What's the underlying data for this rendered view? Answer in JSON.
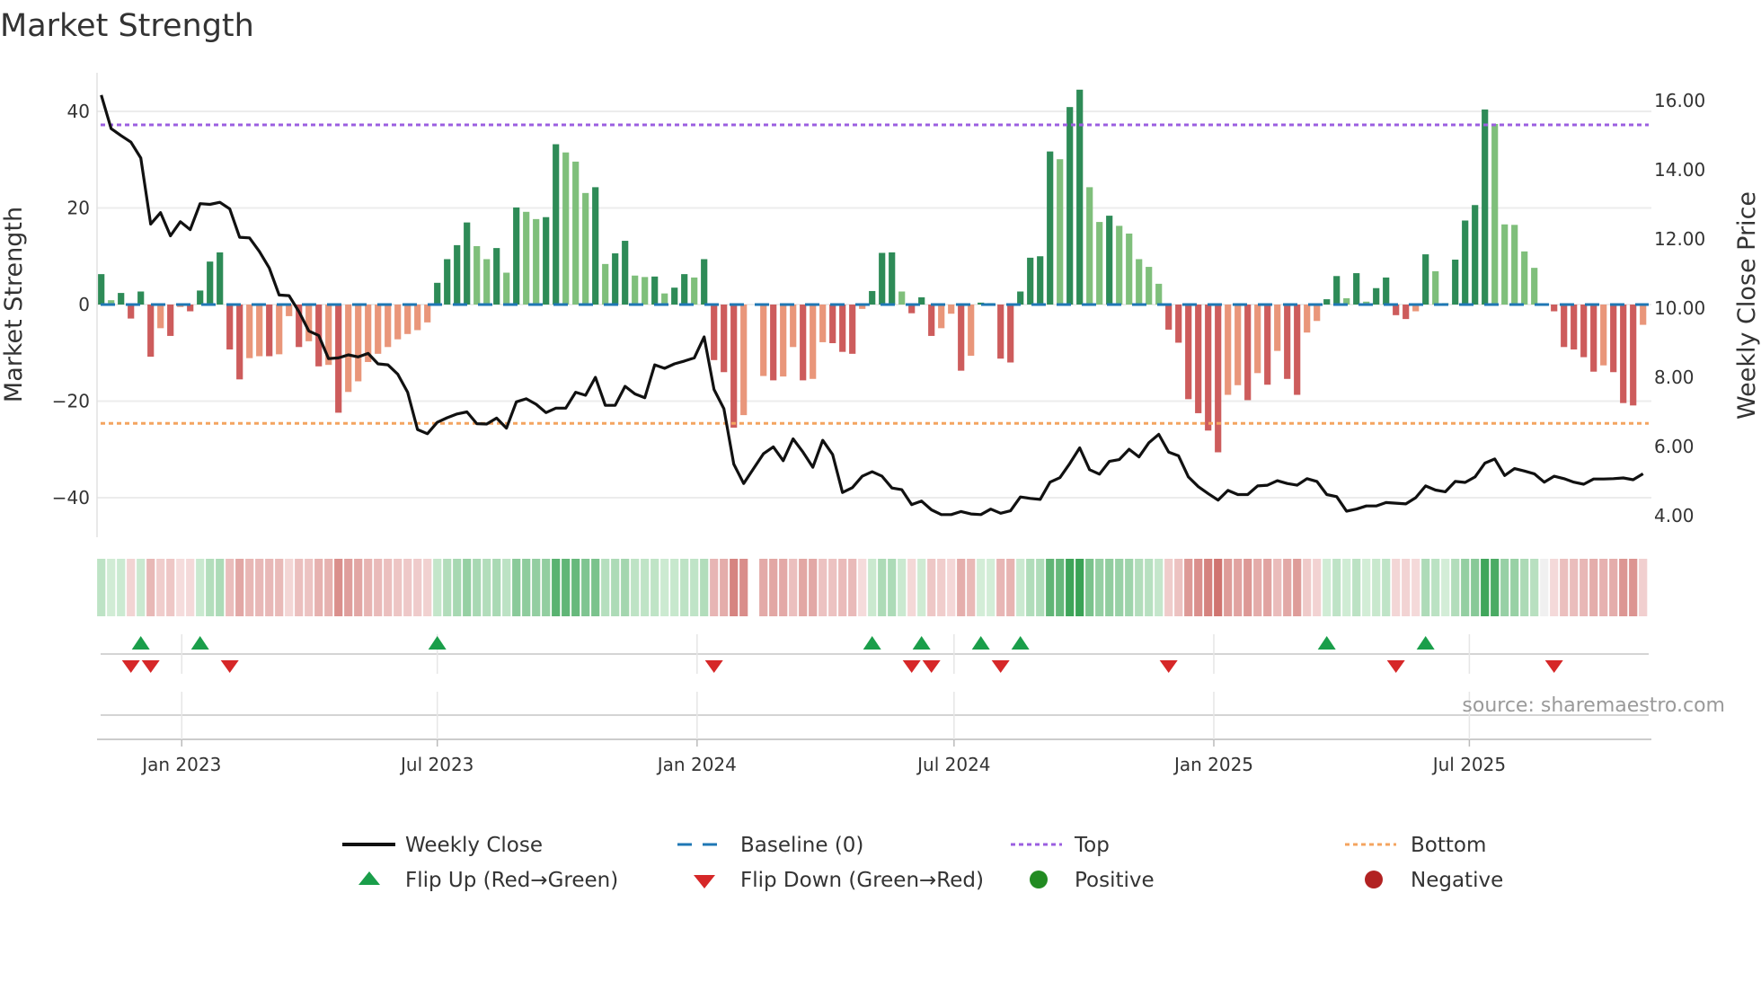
{
  "title": "Market Strength",
  "source": "source: sharemaestro.com",
  "colors": {
    "pos_rising": "#2e8b57",
    "pos_falling": "#7fbf7b",
    "neg_falling": "#cd5c5c",
    "neg_rising": "#e9967a",
    "baseline": "#1f77b4",
    "top": "#9b5fe0",
    "bottom": "#f4a460",
    "price": "#111111",
    "flip_up": "#1a9e4a",
    "flip_down": "#d62728",
    "positive": "#228b22",
    "negative": "#b22222"
  },
  "legend": {
    "weekly_close": "Weekly Close",
    "baseline": "Baseline (0)",
    "top": "Top",
    "bottom": "Bottom",
    "flip_up": "Flip Up (Red→Green)",
    "flip_down": "Flip Down (Green→Red)",
    "positive": "Positive",
    "negative": "Negative"
  },
  "chart_data": {
    "type": "bar+line",
    "title": "Market Strength",
    "ylabel_left": "Market Strength",
    "ylabel_right": "Weekly Close Price",
    "x_start": "2022-11-05",
    "x_interval": "weekly",
    "y_left": {
      "range": [
        -48,
        48
      ],
      "ticks": [
        40,
        20,
        0,
        -20,
        -40
      ],
      "tick_labels": [
        "40",
        "20",
        "0",
        "−20",
        "−40"
      ]
    },
    "y_right": {
      "range": [
        3.4,
        16.7
      ],
      "ticks": [
        16,
        14,
        12,
        10,
        8,
        6,
        4
      ],
      "tick_labels": [
        "16.00",
        "14.00",
        "12.00",
        "10.00",
        "8.00",
        "6.00",
        "4.00"
      ]
    },
    "x_ticks": [
      {
        "date": "2023-01-01",
        "label": "Jan 2023"
      },
      {
        "date": "2023-07-01",
        "label": "Jul 2023"
      },
      {
        "date": "2024-01-01",
        "label": "Jan 2024"
      },
      {
        "date": "2024-07-01",
        "label": "Jul 2024"
      },
      {
        "date": "2025-01-01",
        "label": "Jan 2025"
      },
      {
        "date": "2025-07-01",
        "label": "Jul 2025"
      }
    ],
    "top_level": 37.2,
    "bottom_level": -24.6,
    "baseline": 0,
    "strength": [
      6.3,
      0.9,
      2.4,
      -2.9,
      2.7,
      -10.8,
      -4.9,
      -6.5,
      -0.5,
      -1.4,
      2.9,
      8.9,
      10.8,
      -9.3,
      -15.5,
      -11.1,
      -10.7,
      -10.7,
      -10.3,
      -2.4,
      -8.8,
      -7.6,
      -12.8,
      -12.5,
      -22.4,
      -18.1,
      -15.9,
      -11.9,
      -10.2,
      -8.8,
      -7.2,
      -6.1,
      -5.3,
      -3.7,
      4.5,
      9.4,
      12.3,
      17.0,
      12.1,
      9.4,
      11.7,
      6.6,
      20.1,
      19.2,
      17.7,
      18.1,
      33.2,
      31.5,
      29.6,
      23.1,
      24.3,
      8.4,
      10.6,
      13.2,
      6.0,
      5.7,
      5.8,
      2.3,
      3.5,
      6.3,
      5.6,
      9.4,
      -11.5,
      -14.0,
      -25.5,
      -22.9,
      null,
      -14.8,
      -15.7,
      -14.9,
      -8.8,
      -15.7,
      -15.4,
      -7.8,
      -8.0,
      -9.8,
      -10.2,
      -0.9,
      2.8,
      10.7,
      10.8,
      2.7,
      -1.8,
      1.5,
      -6.5,
      -4.9,
      -1.9,
      -13.7,
      -10.6,
      0.4,
      0.3,
      -11.2,
      -12.0,
      2.7,
      9.7,
      10.0,
      31.7,
      30.1,
      40.9,
      44.5,
      24.3,
      17.1,
      18.4,
      16.3,
      14.7,
      9.4,
      7.8,
      4.3,
      -5.2,
      -7.9,
      -19.6,
      -22.5,
      -26.1,
      -30.6,
      -18.7,
      -16.7,
      -19.8,
      -14.2,
      -16.6,
      -9.6,
      -15.4,
      -18.7,
      -5.8,
      -3.4,
      1.1,
      5.9,
      1.3,
      6.5,
      0.6,
      3.4,
      5.6,
      -2.2,
      -3.0,
      -1.4,
      10.4,
      6.9,
      0.3,
      9.3,
      17.4,
      20.6,
      40.4,
      37.4,
      16.6,
      16.5,
      11.0,
      7.6,
      0,
      -1.4,
      -8.8,
      -9.3,
      -10.9,
      -13.9,
      -12.6,
      -14.0,
      -20.4,
      -20.9,
      -4.2
    ],
    "weekly_close": [
      16.16,
      15.19,
      14.99,
      14.8,
      14.34,
      12.43,
      12.76,
      12.09,
      12.5,
      12.27,
      13.02,
      13.0,
      13.06,
      12.87,
      12.05,
      12.03,
      11.64,
      11.16,
      10.38,
      10.36,
      9.9,
      9.34,
      9.21,
      8.54,
      8.56,
      8.65,
      8.59,
      8.69,
      8.39,
      8.36,
      8.09,
      7.57,
      6.49,
      6.37,
      6.7,
      6.83,
      6.94,
      7.0,
      6.66,
      6.65,
      6.82,
      6.53,
      7.29,
      7.38,
      7.22,
      6.98,
      7.11,
      7.11,
      7.57,
      7.48,
      8.0,
      7.19,
      7.19,
      7.74,
      7.52,
      7.41,
      8.36,
      8.26,
      8.39,
      8.47,
      8.56,
      9.17,
      7.65,
      7.09,
      5.49,
      4.93,
      5.36,
      5.79,
      5.99,
      5.59,
      6.22,
      5.84,
      5.4,
      6.18,
      5.77,
      4.67,
      4.81,
      5.14,
      5.27,
      5.14,
      4.8,
      4.75,
      4.32,
      4.42,
      4.17,
      4.03,
      4.03,
      4.12,
      4.05,
      4.03,
      4.19,
      4.07,
      4.14,
      4.54,
      4.5,
      4.47,
      4.97,
      5.1,
      5.51,
      5.96,
      5.33,
      5.2,
      5.57,
      5.62,
      5.92,
      5.7,
      6.11,
      6.35,
      5.84,
      5.73,
      5.12,
      4.84,
      4.64,
      4.45,
      4.73,
      4.61,
      4.61,
      4.86,
      4.88,
      5.01,
      4.93,
      4.88,
      5.07,
      4.99,
      4.61,
      4.55,
      4.13,
      4.19,
      4.28,
      4.28,
      4.38,
      4.36,
      4.34,
      4.52,
      4.86,
      4.74,
      4.69,
      4.99,
      4.96,
      5.12,
      5.52,
      5.64,
      5.16,
      5.36,
      5.29,
      5.21,
      4.97,
      5.14,
      5.07,
      4.97,
      4.91,
      5.06,
      5.06,
      5.07,
      5.09,
      5.04,
      5.21
    ],
    "flip_up_weeks": [
      5,
      11,
      35,
      79,
      84,
      90,
      94,
      125,
      135
    ],
    "flip_down_weeks": [
      4,
      6,
      14,
      63,
      83,
      85,
      92,
      109,
      132,
      148
    ],
    "grid": true,
    "legend_position": "bottom"
  }
}
